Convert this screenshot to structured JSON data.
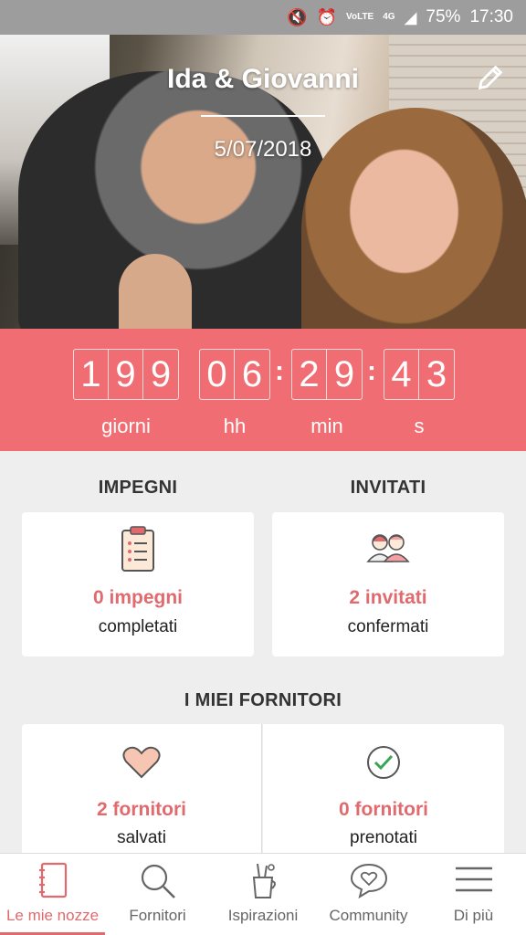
{
  "statusbar": {
    "volte": "VoLTE",
    "network": "4G",
    "battery": "75%",
    "time": "17:30"
  },
  "hero": {
    "names": "Ida & Giovanni",
    "date": "5/07/2018"
  },
  "countdown": {
    "days": [
      "1",
      "9",
      "9"
    ],
    "hours": [
      "0",
      "6"
    ],
    "minutes": [
      "2",
      "9"
    ],
    "seconds": [
      "4",
      "3"
    ],
    "labels": {
      "days": "giorni",
      "hours": "hh",
      "minutes": "min",
      "seconds": "s"
    }
  },
  "tasks": {
    "title": "IMPEGNI",
    "count": "0 impegni",
    "subtitle": "completati"
  },
  "guests": {
    "title": "INVITATI",
    "count": "2 invitati",
    "subtitle": "confermati"
  },
  "vendors": {
    "title": "I MIEI FORNITORI",
    "saved_count": "2 fornitori",
    "saved_subtitle": "salvati",
    "booked_count": "0 fornitori",
    "booked_subtitle": "prenotati"
  },
  "nav": {
    "items": [
      {
        "label": "Le mie nozze",
        "icon": "notebook-icon"
      },
      {
        "label": "Fornitori",
        "icon": "search-icon"
      },
      {
        "label": "Ispirazioni",
        "icon": "pencil-cup-icon"
      },
      {
        "label": "Community",
        "icon": "chat-heart-icon"
      },
      {
        "label": "Di più",
        "icon": "menu-icon"
      }
    ]
  },
  "colors": {
    "accent": "#f06e73",
    "accent_text": "#e06a6d"
  }
}
